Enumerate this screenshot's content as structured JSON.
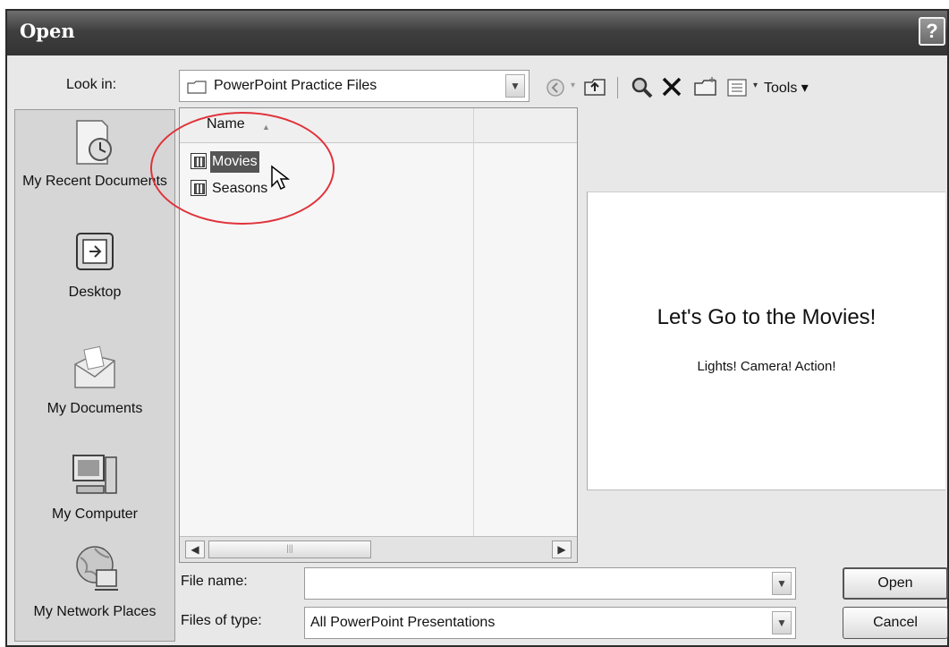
{
  "dialog": {
    "title": "Open",
    "help_label": "?"
  },
  "lookin": {
    "label": "Look in:",
    "value": "PowerPoint Practice Files"
  },
  "toolbar": {
    "tools_label": "Tools ▾"
  },
  "places": [
    {
      "label": "My Recent Documents",
      "icon": "recent-documents-icon"
    },
    {
      "label": "Desktop",
      "icon": "desktop-icon"
    },
    {
      "label": "My Documents",
      "icon": "my-documents-icon"
    },
    {
      "label": "My Computer",
      "icon": "my-computer-icon"
    },
    {
      "label": "My Network Places",
      "icon": "network-places-icon"
    }
  ],
  "filelist": {
    "column_header": "Name",
    "files": [
      {
        "name": "Movies",
        "selected": true
      },
      {
        "name": "Seasons",
        "selected": false
      }
    ]
  },
  "preview": {
    "title": "Let's Go to the Movies!",
    "subtitle": "Lights! Camera! Action!"
  },
  "form": {
    "filename_label": "File name:",
    "filename_value": "",
    "filetype_label": "Files of type:",
    "filetype_value": "All PowerPoint Presentations"
  },
  "buttons": {
    "open": "Open",
    "cancel": "Cancel"
  },
  "colors": {
    "highlight_circle": "#e0323a",
    "selection": "#555555"
  }
}
